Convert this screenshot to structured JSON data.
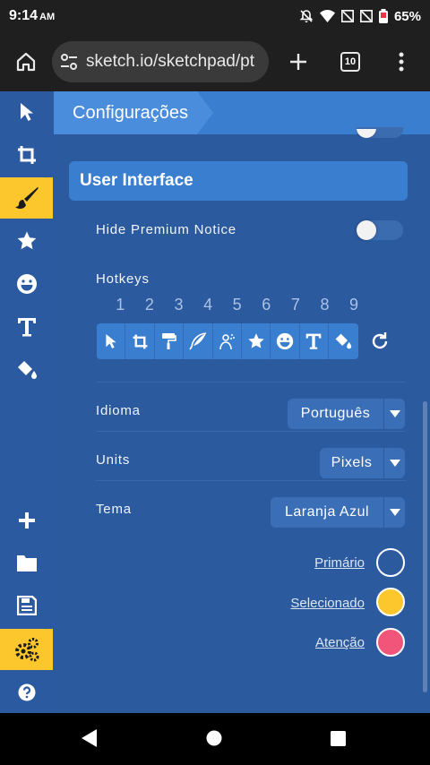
{
  "status": {
    "time": "9:14",
    "ampm": "AM",
    "battery": "65%"
  },
  "browser": {
    "url": "sketch.io/sketchpad/pt",
    "tab_count": "10"
  },
  "toolbar": {
    "tools": [
      {
        "name": "select-tool",
        "icon": "cursor-icon"
      },
      {
        "name": "crop-tool",
        "icon": "crop-icon"
      },
      {
        "name": "brush-tool",
        "icon": "brush-icon",
        "active": true
      },
      {
        "name": "stamp-tool",
        "icon": "star-icon"
      },
      {
        "name": "emoji-tool",
        "icon": "grin-icon"
      },
      {
        "name": "text-tool",
        "icon": "text-icon"
      },
      {
        "name": "fill-tool",
        "icon": "paint-bucket-icon"
      },
      {
        "name": "new-button",
        "icon": "plus-icon"
      },
      {
        "name": "open-button",
        "icon": "folder-icon"
      },
      {
        "name": "save-button",
        "icon": "save-icon"
      },
      {
        "name": "settings-button",
        "icon": "gears-icon",
        "active": true
      },
      {
        "name": "help-button",
        "icon": "help-icon"
      }
    ]
  },
  "header": {
    "title": "Configurações"
  },
  "section": {
    "title": "User Interface"
  },
  "settings": {
    "hide_premium_label": "Hide Premium Notice",
    "hide_premium_on": false,
    "hotkeys_label": "Hotkeys",
    "hotkey_numbers": [
      "1",
      "2",
      "3",
      "4",
      "5",
      "6",
      "7",
      "8",
      "9"
    ],
    "hotkey_icons": [
      "cursor-icon",
      "crop-icon",
      "paint-roller-icon",
      "feather-icon",
      "person-icon",
      "star-icon",
      "grin-icon",
      "text-icon",
      "paint-bucket-icon"
    ],
    "idioma_label": "Idioma",
    "idioma_value": "Português",
    "units_label": "Units",
    "units_value": "Pixels",
    "tema_label": "Tema",
    "tema_value": "Laranja Azul"
  },
  "colors": {
    "primario_label": "Primário",
    "primario_color": "#2c5a9f",
    "selecionado_label": "Selecionado",
    "selecionado_color": "#fcc62d",
    "atencao_label": "Atenção",
    "atencao_color": "#f2557a"
  }
}
